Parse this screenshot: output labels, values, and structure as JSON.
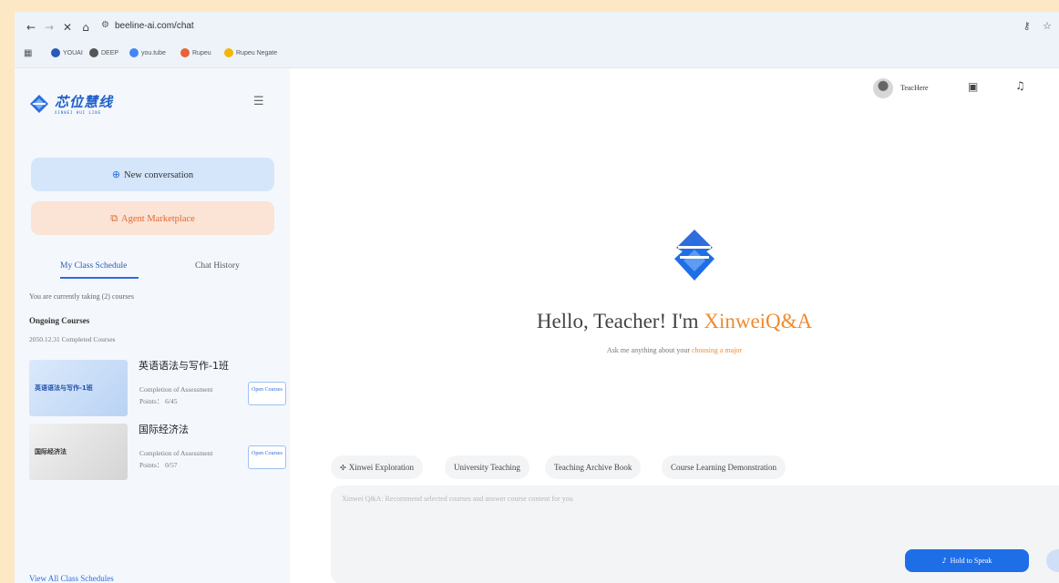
{
  "browser": {
    "url": "beeline-ai.com/chat",
    "bookmarks": [
      "YOUAI",
      "DEEP",
      "you.tube",
      "Rupeu",
      "Rupeu Negate"
    ]
  },
  "sidebar": {
    "logo_text": "芯位慧线",
    "logo_sub": "XINWEI HUI LINE",
    "new_conversation": "New conversation",
    "agent_marketplace": "Agent Marketplace",
    "tabs": [
      "My Class Schedule",
      "Chat History"
    ],
    "taking_text": "You are currently taking (2) courses",
    "ongoing_label": "Ongoing Courses",
    "completed_label": "2050.12.31 Completed Courses",
    "courses": [
      {
        "title": "英语语法与写作-1班",
        "thumb_label": "英语语法与写作-1班",
        "completion": "Completion of Assessment",
        "points": "Points：  6/45",
        "open_label": "Open Courses"
      },
      {
        "title": "国际经济法",
        "thumb_label": "国际经济法",
        "completion": "Completion of Assessment",
        "points": "Points：  0/57",
        "open_label": "Open Courses"
      }
    ],
    "view_all": "View All Class Schedules"
  },
  "header": {
    "username": "TeacHere"
  },
  "main": {
    "hello_prefix": "Hello, Teacher! I'm ",
    "hello_brand": "XinweiQ&A",
    "ask_prefix": "Ask me anything about your ",
    "ask_highlight": "choosing a major",
    "chips": [
      "Xinwei Exploration",
      "University Teaching",
      "Teaching Archive Book",
      "Course Learning Demonstration"
    ],
    "input_placeholder": "Xinwei Q&A: Recommend selected courses and answer course content for you",
    "hold_to_speak": "Hold to Speak"
  },
  "colors": {
    "accent_blue": "#1e6ee8",
    "accent_orange": "#f08a2c",
    "page_bg": "#fde8c6"
  }
}
